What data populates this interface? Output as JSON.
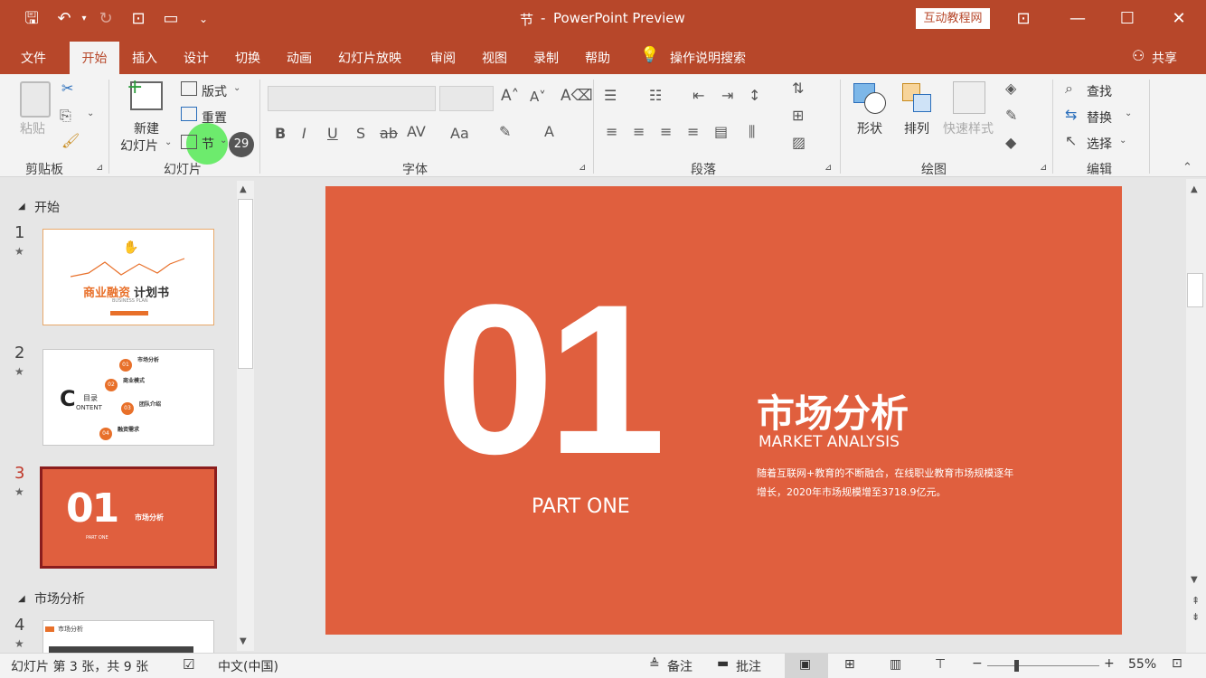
{
  "window": {
    "doc_title": "节",
    "app_name": "PowerPoint Preview",
    "tutorial_badge": "互动教程网"
  },
  "menu": {
    "items": [
      "文件",
      "开始",
      "插入",
      "设计",
      "切换",
      "动画",
      "幻灯片放映",
      "审阅",
      "视图",
      "录制",
      "帮助"
    ],
    "active": "开始",
    "tell_me": "操作说明搜索",
    "share": "共享"
  },
  "ribbon": {
    "clipboard": {
      "label": "剪贴板",
      "paste": "粘贴"
    },
    "slides": {
      "label": "幻灯片",
      "new_slide_1": "新建",
      "new_slide_2": "幻灯片",
      "layout": "版式",
      "reset": "重置",
      "section": "节",
      "badge": "29"
    },
    "font": {
      "label": "字体"
    },
    "paragraph": {
      "label": "段落"
    },
    "drawing": {
      "label": "绘图",
      "shapes": "形状",
      "arrange": "排列",
      "quick_styles": "快速样式"
    },
    "editing": {
      "label": "编辑",
      "find": "查找",
      "replace": "替换",
      "select": "选择"
    }
  },
  "thumbs": {
    "section1": "开始",
    "section2": "市场分析",
    "slide1": {
      "num": "1",
      "title_a": "商业融资",
      "title_b": "计划书",
      "sub": "BUSINESS PLAN"
    },
    "slide2": {
      "num": "2",
      "c": "C",
      "mulu": "目录",
      "ontent": "ONTENT",
      "items": [
        {
          "n": "01",
          "t": "市场分析"
        },
        {
          "n": "02",
          "t": "商业模式"
        },
        {
          "n": "03",
          "t": "团队介绍"
        },
        {
          "n": "04",
          "t": "融资需求"
        }
      ]
    },
    "slide3": {
      "num": "3",
      "big": "01",
      "title": "市场分析",
      "part": "PART ONE"
    },
    "slide4": {
      "num": "4",
      "title": "市场分析"
    }
  },
  "slide": {
    "big_number": "01",
    "part": "PART ONE",
    "title": "市场分析",
    "subtitle": "MARKET ANALYSIS",
    "body_line1": "随着互联网+教育的不断融合，在线职业教育市场规模逐年",
    "body_line2": "增长，2020年市场规模增至3718.9亿元。"
  },
  "status": {
    "slide_info": "幻灯片 第 3 张，共 9 张",
    "language": "中文(中国)",
    "notes": "备注",
    "comments": "批注",
    "zoom": "55%"
  },
  "colors": {
    "accent": "#b7472a",
    "slide_bg": "#e05f3e"
  }
}
